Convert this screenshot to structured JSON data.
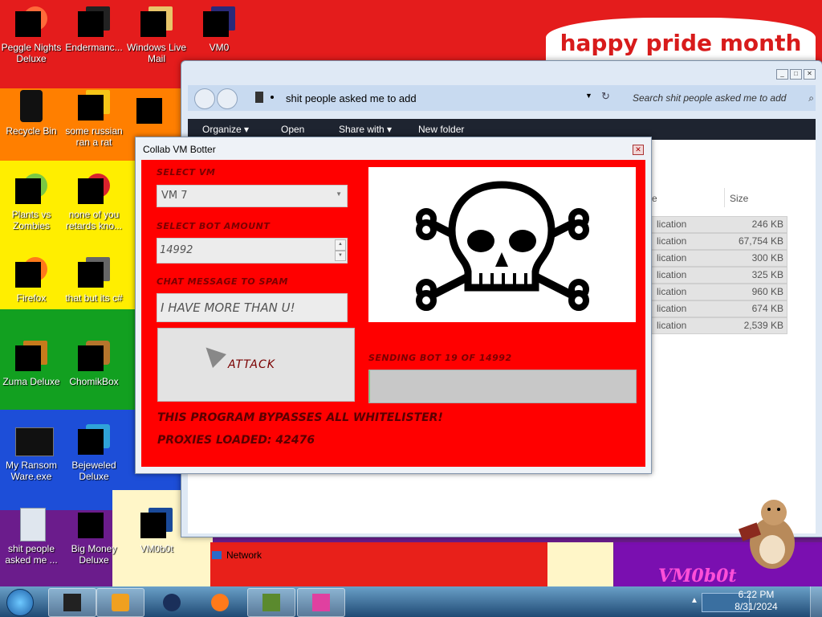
{
  "wallpaper": {
    "message": "happy pride month",
    "brand": "VM0b0t"
  },
  "desktop_icons": [
    {
      "label": "Peggle Nights Deluxe",
      "icon": "peggle-icon"
    },
    {
      "label": "Endermanc...",
      "icon": "enderman-icon"
    },
    {
      "label": "Windows Live Mail",
      "icon": "mail-folder-icon"
    },
    {
      "label": "VM0",
      "icon": "vm0-icon"
    },
    {
      "label": "Recycle Bin",
      "icon": "recycle-bin-icon"
    },
    {
      "label": "some russian ran a rat",
      "icon": "russian-rat-icon"
    },
    {
      "label": "Plants vs Zombies",
      "icon": "plants-vs-zombies-icon"
    },
    {
      "label": "none of you retards kno...",
      "icon": "generic-app-icon"
    },
    {
      "label": "Firefox",
      "icon": "firefox-icon"
    },
    {
      "label": "that but its c#",
      "icon": "csharp-app-icon"
    },
    {
      "label": "Zuma Deluxe",
      "icon": "zuma-icon"
    },
    {
      "label": "ChomikBox",
      "icon": "chomikbox-icon"
    },
    {
      "label": "My Ransom Ware.exe",
      "icon": "ransomware-icon"
    },
    {
      "label": "Bejeweled Deluxe",
      "icon": "bejeweled-icon"
    },
    {
      "label": "shit people asked me ...",
      "icon": "folder-icon"
    },
    {
      "label": "Big Money Deluxe",
      "icon": "big-money-icon"
    },
    {
      "label": "VM0b0t",
      "icon": "vm0b0t-icon"
    }
  ],
  "explorer": {
    "address": "shit people asked me to add",
    "search_placeholder": "Search shit people asked me to add",
    "toolbar": {
      "organize": "Organize ▾",
      "open": "Open",
      "share": "Share with ▾",
      "new_folder": "New folder"
    },
    "columns": {
      "type_partial": "e",
      "size": "Size"
    },
    "rows": [
      {
        "type": "lication",
        "size": "246 KB"
      },
      {
        "type": "lication",
        "size": "67,754 KB"
      },
      {
        "type": "lication",
        "size": "300 KB"
      },
      {
        "type": "lication",
        "size": "325 KB"
      },
      {
        "type": "lication",
        "size": "960 KB"
      },
      {
        "type": "lication",
        "size": "674 KB"
      },
      {
        "type": "lication",
        "size": "2,539 KB"
      }
    ],
    "network_label": "Network"
  },
  "botter": {
    "title": "Collab VM Botter",
    "select_vm_label": "SELECT VM",
    "select_vm_value": "VM 7",
    "bot_amount_label": "SELECT BOT AMOUNT",
    "bot_amount_value": "14992",
    "chat_label": "CHAT MESSAGE TO SPAM",
    "chat_value": "I HAVE MORE THAN U!",
    "attack_label": "ATTACK",
    "sending_status": "SENDING BOT 19 OF 14992",
    "progress_fraction": 0.0013,
    "bypass_text": "THIS PROGRAM BYPASSES ALL WHITELISTER!",
    "proxies_text": "PROXIES LOADED: 42476"
  },
  "taskbar": {
    "time": "6:22 PM",
    "date": "8/31/2024"
  }
}
